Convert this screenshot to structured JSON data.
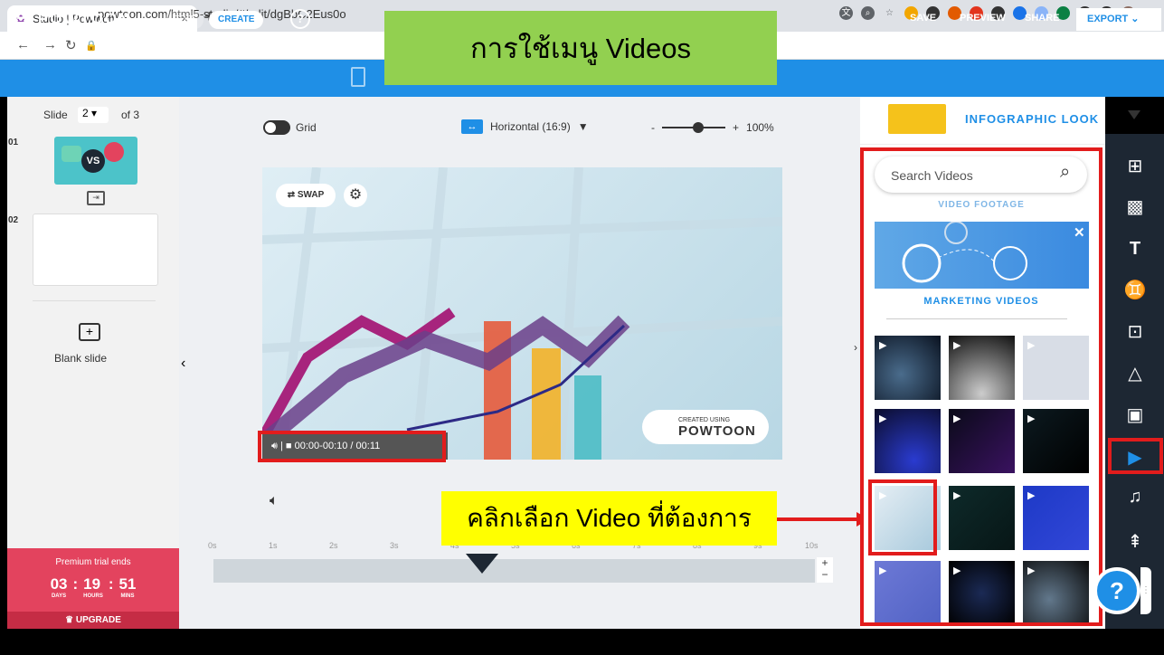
{
  "browser": {
    "tab_title": "Studio | Powtoon",
    "tab_close": "×",
    "new_tab": "+",
    "url": "powtoon.com/html5-studio/#/edit/dgBbC2Eus0o"
  },
  "overlay": {
    "title": "การใช้เมนู Videos",
    "callout": "คลิกเลือก Video ที่ต้องการ"
  },
  "topbar": {
    "logo": "POWTOON",
    "edit_label": "EDIT",
    "create_label": "CREATE",
    "help_label": "?",
    "save_label": "SAVE",
    "preview_label": "PREVIEW",
    "share_label": "SHARE",
    "export_label": "EXPORT"
  },
  "slides": {
    "slide_label": "Slide",
    "current": "2",
    "of_label": "of 3",
    "item1_num": "01",
    "item2_num": "02",
    "blank_label": "Blank slide",
    "vs_text": "VS"
  },
  "premium": {
    "title": "Premium trial ends",
    "days": "03",
    "hours": "19",
    "mins": "51",
    "days_label": "DAYS",
    "hours_label": "HOURS",
    "mins_label": "MINS",
    "upgrade": "UPGRADE"
  },
  "canvas_toolbar": {
    "grid_label": "Grid",
    "orientation": "Horizontal (16:9)",
    "zoom_minus": "-",
    "zoom_plus": "+",
    "zoom_value": "100%"
  },
  "canvas": {
    "swap_label": "SWAP",
    "time_range": "00:00-00:10 / 00:11",
    "watermark_small": "CREATED USING",
    "watermark_big": "POWTOON"
  },
  "timeline": {
    "ticks": [
      "0s",
      "1s",
      "2s",
      "3s",
      "4s",
      "5s",
      "6s",
      "7s",
      "8s",
      "9s",
      "10s"
    ]
  },
  "right_panel": {
    "style_label": "INFOGRAPHIC LOOK",
    "search_placeholder": "Search Videos",
    "footage_label": "VIDEO FOOTAGE",
    "marketing_label": "MARKETING VIDEOS"
  },
  "colors": {
    "brand_blue": "#1f8fe6",
    "highlight_red": "#e21c1c",
    "title_green": "#92d050",
    "callout_yellow": "#ffff00",
    "premium_pink": "#e3435e",
    "iconbar_dark": "#1d2733"
  },
  "icons": [
    "layout-icon",
    "backgrounds-icon",
    "text-icon",
    "characters-icon",
    "props-icon",
    "shapes-icon",
    "images-icon",
    "videos-icon",
    "music-icon",
    "transitions-icon"
  ]
}
